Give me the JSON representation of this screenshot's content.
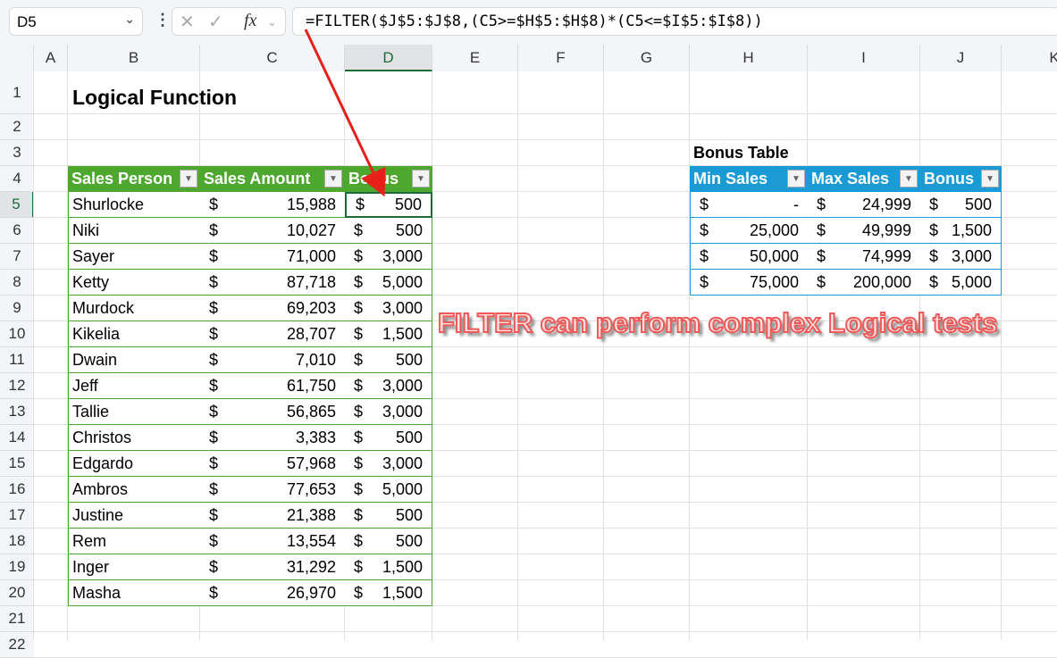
{
  "formula_bar": {
    "name_box": "D5",
    "formula": "=FILTER($J$5:$J$8,(C5>=$H$5:$H$8)*(C5<=$I$5:$I$8))",
    "fx_label": "fx"
  },
  "columns": [
    "A",
    "B",
    "C",
    "D",
    "E",
    "F",
    "G",
    "H",
    "I",
    "J",
    "K"
  ],
  "rows": [
    "1",
    "2",
    "3",
    "4",
    "5",
    "6",
    "7",
    "8",
    "9",
    "10",
    "11",
    "12",
    "13",
    "14",
    "15",
    "16",
    "17",
    "18",
    "19",
    "20",
    "21",
    "22"
  ],
  "title": "Logical Function",
  "sales_table": {
    "headers": [
      "Sales Person",
      "Sales Amount",
      "Bonus"
    ],
    "rows": [
      [
        "Shurlocke",
        "15,988",
        "500"
      ],
      [
        "Niki",
        "10,027",
        "500"
      ],
      [
        "Sayer",
        "71,000",
        "3,000"
      ],
      [
        "Ketty",
        "87,718",
        "5,000"
      ],
      [
        "Murdock",
        "69,203",
        "3,000"
      ],
      [
        "Kikelia",
        "28,707",
        "1,500"
      ],
      [
        "Dwain",
        "7,010",
        "500"
      ],
      [
        "Jeff",
        "61,750",
        "3,000"
      ],
      [
        "Tallie",
        "56,865",
        "3,000"
      ],
      [
        "Christos",
        "3,383",
        "500"
      ],
      [
        "Edgardo",
        "57,968",
        "3,000"
      ],
      [
        "Ambros",
        "77,653",
        "5,000"
      ],
      [
        "Justine",
        "21,388",
        "500"
      ],
      [
        "Rem",
        "13,554",
        "500"
      ],
      [
        "Inger",
        "31,292",
        "1,500"
      ],
      [
        "Masha",
        "26,970",
        "1,500"
      ]
    ]
  },
  "bonus_table": {
    "title": "Bonus Table",
    "headers": [
      "Min Sales",
      "Max Sales",
      "Bonus"
    ],
    "rows": [
      [
        "-",
        "24,999",
        "500"
      ],
      [
        "25,000",
        "49,999",
        "1,500"
      ],
      [
        "50,000",
        "74,999",
        "3,000"
      ],
      [
        "75,000",
        "200,000",
        "5,000"
      ]
    ]
  },
  "currency": "$",
  "annotation": "FILTER can perform complex Logical tests",
  "colors": {
    "green_header": "#4ea72e",
    "blue_header": "#1a9bd6",
    "arrow": "#e8201a"
  }
}
